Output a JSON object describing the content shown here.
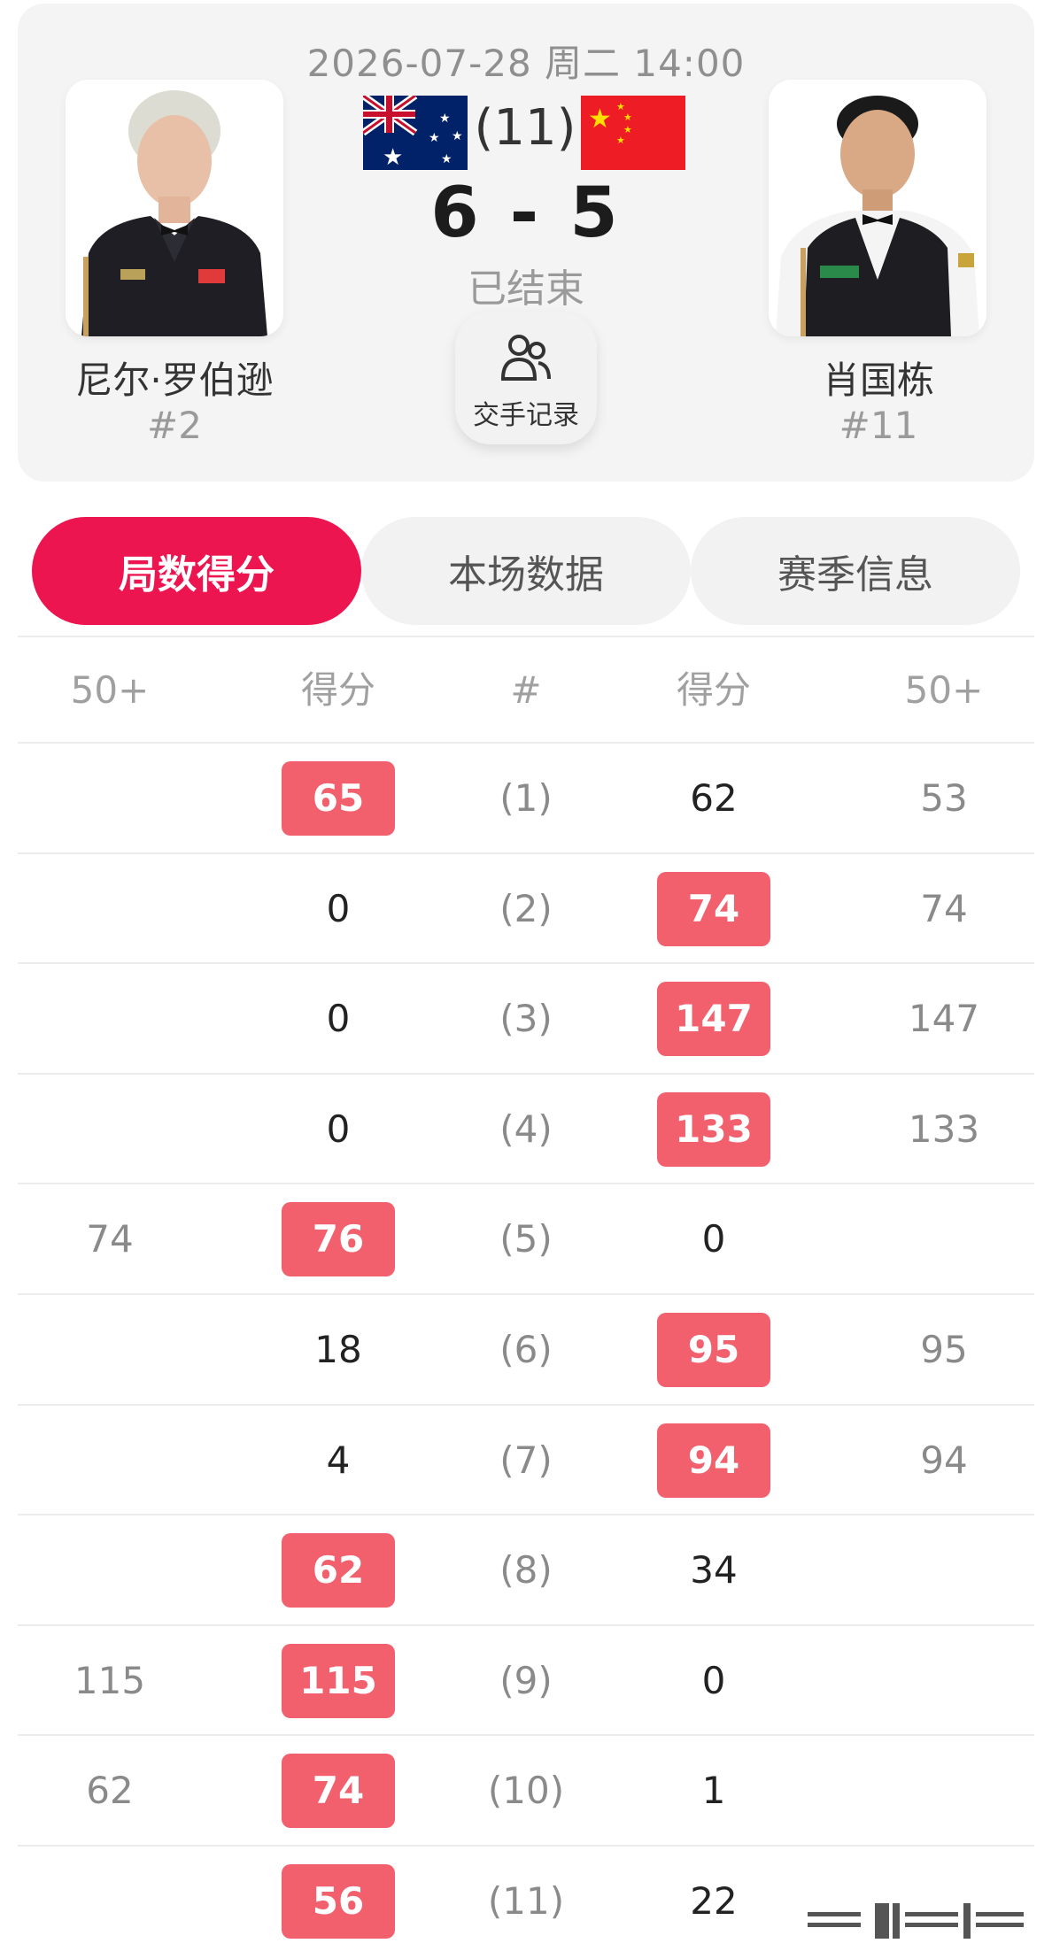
{
  "match": {
    "datetime": "2026-07-28 周二 14:00",
    "best_of": "(11)",
    "score": "6 - 5",
    "status": "已结束",
    "head_to_head_label": "交手记录"
  },
  "players": {
    "left": {
      "name": "尼尔·罗伯逊",
      "rank": "#2",
      "country_flag": "australia-flag"
    },
    "right": {
      "name": "肖国栋",
      "rank": "#11",
      "country_flag": "china-flag"
    }
  },
  "tabs": [
    {
      "label": "局数得分",
      "active": true
    },
    {
      "label": "本场数据",
      "active": false
    },
    {
      "label": "赛季信息",
      "active": false
    }
  ],
  "table": {
    "headers": [
      "50+",
      "得分",
      "#",
      "得分",
      "50+"
    ],
    "rows": [
      {
        "left_50": "",
        "left_score": "65",
        "frame": "(1)",
        "right_score": "62",
        "right_50": "53",
        "winner": "left"
      },
      {
        "left_50": "",
        "left_score": "0",
        "frame": "(2)",
        "right_score": "74",
        "right_50": "74",
        "winner": "right"
      },
      {
        "left_50": "",
        "left_score": "0",
        "frame": "(3)",
        "right_score": "147",
        "right_50": "147",
        "winner": "right"
      },
      {
        "left_50": "",
        "left_score": "0",
        "frame": "(4)",
        "right_score": "133",
        "right_50": "133",
        "winner": "right"
      },
      {
        "left_50": "74",
        "left_score": "76",
        "frame": "(5)",
        "right_score": "0",
        "right_50": "",
        "winner": "left"
      },
      {
        "left_50": "",
        "left_score": "18",
        "frame": "(6)",
        "right_score": "95",
        "right_50": "95",
        "winner": "right"
      },
      {
        "left_50": "",
        "left_score": "4",
        "frame": "(7)",
        "right_score": "94",
        "right_50": "94",
        "winner": "right"
      },
      {
        "left_50": "",
        "left_score": "62",
        "frame": "(8)",
        "right_score": "34",
        "right_50": "",
        "winner": "left"
      },
      {
        "left_50": "115",
        "left_score": "115",
        "frame": "(9)",
        "right_score": "0",
        "right_50": "",
        "winner": "left"
      },
      {
        "left_50": "62",
        "left_score": "74",
        "frame": "(10)",
        "right_score": "1",
        "right_50": "",
        "winner": "left"
      },
      {
        "left_50": "",
        "left_score": "56",
        "frame": "(11)",
        "right_score": "22",
        "right_50": "",
        "winner": "left"
      }
    ]
  },
  "colors": {
    "accent": "#ec1550",
    "win_badge": "#f2606d",
    "card_bg": "#f4f4f4"
  }
}
